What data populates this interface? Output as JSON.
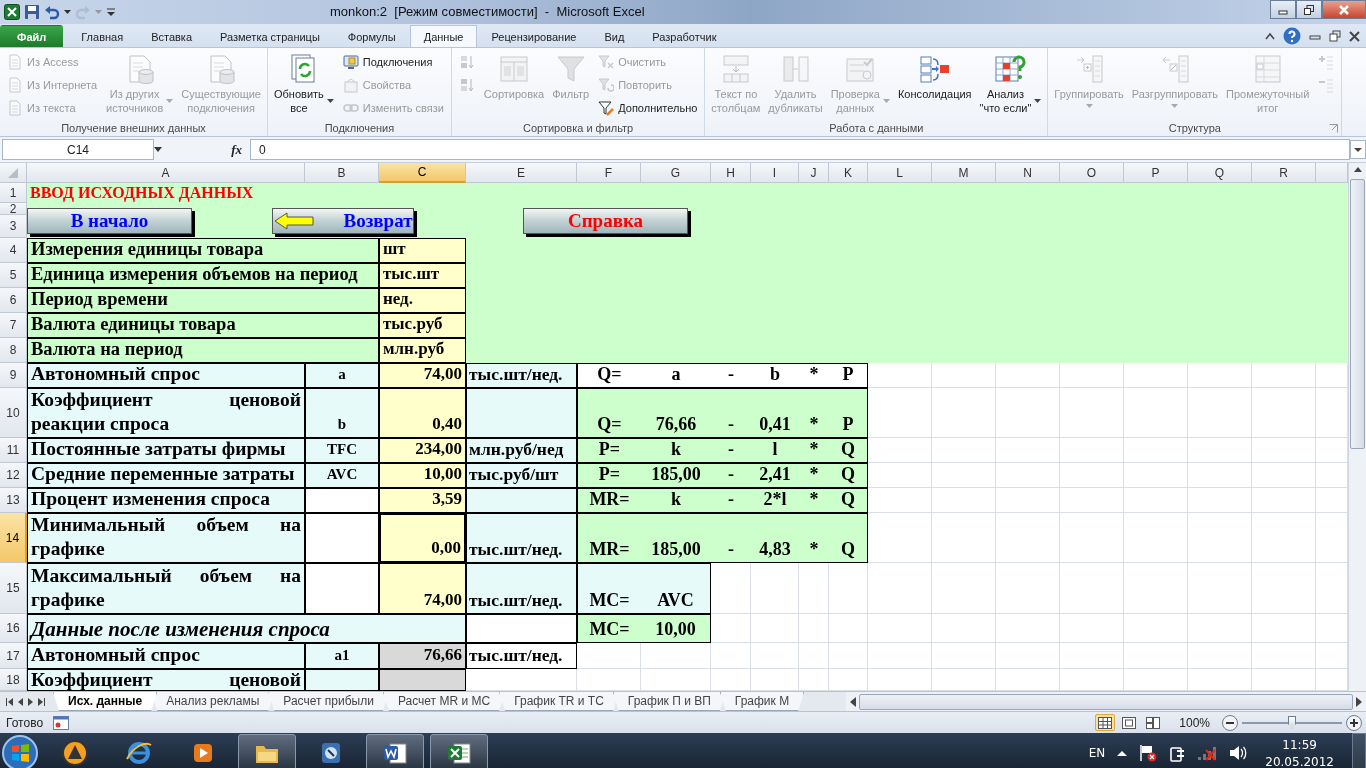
{
  "title_bar": {
    "title": "monkon:2  [Режим совместимости]  -  Microsoft Excel"
  },
  "ribbon_tabs": [
    {
      "label": "Файл",
      "kind": "file",
      "selected": false
    },
    {
      "label": "Главная",
      "kind": "tab",
      "selected": false
    },
    {
      "label": "Вставка",
      "kind": "tab",
      "selected": false
    },
    {
      "label": "Разметка страницы",
      "kind": "tab",
      "selected": false
    },
    {
      "label": "Формулы",
      "kind": "tab",
      "selected": false
    },
    {
      "label": "Данные",
      "kind": "tab",
      "selected": true
    },
    {
      "label": "Рецензирование",
      "kind": "tab",
      "selected": false
    },
    {
      "label": "Вид",
      "kind": "tab",
      "selected": false
    },
    {
      "label": "Разработчик",
      "kind": "tab",
      "selected": false
    }
  ],
  "ribbon_groups": [
    {
      "title": "Получение внешних данных",
      "launcher": false,
      "items": [
        {
          "kind": "small",
          "label": "Из Access",
          "disabled": true
        },
        {
          "kind": "small",
          "label": "Из Интернета",
          "disabled": true
        },
        {
          "kind": "small",
          "label": "Из текста",
          "disabled": true
        },
        {
          "kind": "large",
          "label": "Из других\nисточников",
          "disabled": true,
          "dropdown": true
        },
        {
          "kind": "large",
          "label": "Существующие\nподключения",
          "disabled": true,
          "dropdown": false
        }
      ]
    },
    {
      "title": "Подключения",
      "launcher": false,
      "items": [
        {
          "kind": "large",
          "label": "Обновить\nвсе",
          "disabled": false,
          "dropdown": true
        },
        {
          "kind": "small",
          "label": "Подключения",
          "disabled": false
        },
        {
          "kind": "small",
          "label": "Свойства",
          "disabled": true
        },
        {
          "kind": "small",
          "label": "Изменить связи",
          "disabled": true
        }
      ]
    },
    {
      "title": "Сортировка и фильтр",
      "launcher": false,
      "items": [
        {
          "kind": "icon",
          "disabled": true
        },
        {
          "kind": "icon",
          "disabled": true
        },
        {
          "kind": "large",
          "label": "Сортировка",
          "disabled": true,
          "dropdown": false
        },
        {
          "kind": "large",
          "label": "Фильтр",
          "disabled": true,
          "dropdown": false
        },
        {
          "kind": "small",
          "label": "Очистить",
          "disabled": true
        },
        {
          "kind": "small",
          "label": "Повторить",
          "disabled": true
        },
        {
          "kind": "small",
          "label": "Дополнительно",
          "disabled": false
        }
      ]
    },
    {
      "title": "Работа с данными",
      "launcher": false,
      "items": [
        {
          "kind": "large",
          "label": "Текст по\nстолбцам",
          "disabled": true,
          "dropdown": false
        },
        {
          "kind": "large",
          "label": "Удалить\nдубликаты",
          "disabled": true,
          "dropdown": false
        },
        {
          "kind": "large",
          "label": "Проверка\nданных",
          "disabled": true,
          "dropdown": true
        },
        {
          "kind": "large",
          "label": "Консолидация",
          "disabled": false,
          "dropdown": false
        },
        {
          "kind": "large",
          "label": "Анализ\n\"что если\"",
          "disabled": false,
          "dropdown": true
        }
      ]
    },
    {
      "title": "Структура",
      "launcher": true,
      "items": [
        {
          "kind": "large",
          "label": "Группировать",
          "disabled": true,
          "dropdown": true
        },
        {
          "kind": "large",
          "label": "Разгруппировать",
          "disabled": true,
          "dropdown": true
        },
        {
          "kind": "large",
          "label": "Промежуточный\nитог",
          "disabled": true,
          "dropdown": false
        },
        {
          "kind": "icon",
          "disabled": true
        },
        {
          "kind": "icon",
          "disabled": true
        }
      ]
    }
  ],
  "formula_bar": {
    "name_box": "C14",
    "function_label": "fx",
    "formula": "0"
  },
  "sheet": {
    "columns": [
      {
        "label": "A",
        "selected": false
      },
      {
        "label": "B",
        "selected": false
      },
      {
        "label": "C",
        "selected": true
      },
      {
        "label": "E",
        "selected": false
      },
      {
        "label": "F",
        "selected": false
      },
      {
        "label": "G",
        "selected": false
      },
      {
        "label": "H",
        "selected": false
      },
      {
        "label": "I",
        "selected": false
      },
      {
        "label": "J",
        "selected": false
      },
      {
        "label": "K",
        "selected": false
      },
      {
        "label": "L",
        "selected": false
      },
      {
        "label": "M",
        "selected": false
      },
      {
        "label": "N",
        "selected": false
      },
      {
        "label": "O",
        "selected": false
      },
      {
        "label": "P",
        "selected": false
      },
      {
        "label": "Q",
        "selected": false
      },
      {
        "label": "R",
        "selected": false
      }
    ],
    "buttons": [
      {
        "label": "В начало",
        "color": "#0000ff",
        "arrow": false
      },
      {
        "label": "Возврат",
        "color": "#0000ff",
        "arrow": true
      },
      {
        "label": "Справка",
        "color": "#ff0000",
        "arrow": false
      }
    ],
    "rows": [
      {
        "label": "1",
        "selected": false,
        "color": "#ccffcc",
        "cells": [
          {
            "kind": "title",
            "text": "ВВОД ИСХОДНЫХ ДАННЫХ",
            "color": "#ccffcc"
          }
        ]
      },
      {
        "label": "2",
        "selected": false,
        "color": "#ccffcc",
        "cells": []
      },
      {
        "label": "3",
        "selected": false,
        "color": "#ccffcc",
        "cells": []
      },
      {
        "label": "4",
        "selected": false,
        "color": "#ccffcc",
        "cells": [
          {
            "kind": "label-wide",
            "text": "Измерения единицы товара",
            "color": "#ccffcc"
          },
          {
            "kind": "merged"
          },
          {
            "kind": "text-value",
            "text": "шт",
            "color": "#ffffcc"
          }
        ]
      },
      {
        "label": "5",
        "selected": false,
        "color": "#ccffcc",
        "cells": [
          {
            "kind": "label-wide",
            "text": "Единица измерения объемов на период",
            "color": "#ccffcc"
          },
          {
            "kind": "merged"
          },
          {
            "kind": "text-value",
            "text": "тыс.шт",
            "color": "#ffffcc"
          }
        ]
      },
      {
        "label": "6",
        "selected": false,
        "color": "#ccffcc",
        "cells": [
          {
            "kind": "label-wide",
            "text": "Период времени",
            "color": "#ccffcc"
          },
          {
            "kind": "merged"
          },
          {
            "kind": "text-value",
            "text": "нед.",
            "color": "#ffffcc"
          }
        ]
      },
      {
        "label": "7",
        "selected": false,
        "color": "#ccffcc",
        "cells": [
          {
            "kind": "label-wide",
            "text": "Валюта единицы товара",
            "color": "#ccffcc"
          },
          {
            "kind": "merged"
          },
          {
            "kind": "text-value",
            "text": "тыс.руб",
            "color": "#ffffcc"
          }
        ]
      },
      {
        "label": "8",
        "selected": false,
        "color": "#ccffcc",
        "cells": [
          {
            "kind": "label-wide",
            "text": "Валюта на период",
            "color": "#ccffcc"
          },
          {
            "kind": "merged"
          },
          {
            "kind": "text-value",
            "text": "млн.руб",
            "color": "#ffffcc"
          }
        ]
      },
      {
        "label": "9",
        "selected": false,
        "color": "#ffffff",
        "cells": [
          {
            "kind": "label",
            "text": "Автономный  спрос",
            "color": "#e6fafa"
          },
          {
            "kind": "symbol",
            "text": "a",
            "color": "#e6fafa"
          },
          {
            "kind": "value",
            "text": "74,00",
            "color": "#ffffcc"
          },
          {
            "kind": "unit",
            "text": "тыс.шт/нед.",
            "color": "#e6fafa"
          },
          {
            "kind": "eq",
            "text": "Q=",
            "color": "#ffffff"
          },
          {
            "kind": "eq",
            "text": "a",
            "color": "#ffffff"
          },
          {
            "kind": "eq",
            "text": "-",
            "color": "#ffffff"
          },
          {
            "kind": "eq",
            "text": "b",
            "color": "#ffffff"
          },
          {
            "kind": "eq",
            "text": "*",
            "color": "#ffffff"
          },
          {
            "kind": "eq",
            "text": "P",
            "color": "#ffffff"
          }
        ]
      },
      {
        "label": "10",
        "selected": false,
        "color": "#ffffff",
        "cells": [
          {
            "kind": "label",
            "text": "Коэффициент ценовой реакции  спроса",
            "color": "#e6fafa"
          },
          {
            "kind": "symbol",
            "text": "b",
            "color": "#e6fafa"
          },
          {
            "kind": "value",
            "text": "0,40",
            "color": "#ffffcc"
          },
          {
            "kind": "blank",
            "color": "#e6fafa"
          },
          {
            "kind": "eq",
            "text": "Q=",
            "color": "#ccffcc"
          },
          {
            "kind": "eq",
            "text": "76,66",
            "color": "#ccffcc"
          },
          {
            "kind": "eq",
            "text": "-",
            "color": "#ccffcc"
          },
          {
            "kind": "eq",
            "text": "0,41",
            "color": "#ccffcc"
          },
          {
            "kind": "eq",
            "text": "*",
            "color": "#ccffcc"
          },
          {
            "kind": "eq",
            "text": "P",
            "color": "#ccffcc"
          }
        ]
      },
      {
        "label": "11",
        "selected": false,
        "color": "#ffffff",
        "cells": [
          {
            "kind": "label",
            "text": "Постоянные затраты фирмы",
            "color": "#e6fafa"
          },
          {
            "kind": "symbol",
            "text": "TFC",
            "color": "#e6fafa"
          },
          {
            "kind": "value",
            "text": "234,00",
            "color": "#ffffcc"
          },
          {
            "kind": "unit",
            "text": "млн.руб/нед",
            "color": "#e6fafa"
          },
          {
            "kind": "eq",
            "text": "P=",
            "color": "#ccffcc"
          },
          {
            "kind": "eq",
            "text": "k",
            "color": "#ccffcc"
          },
          {
            "kind": "eq",
            "text": "-",
            "color": "#ccffcc"
          },
          {
            "kind": "eq",
            "text": "l",
            "color": "#ccffcc"
          },
          {
            "kind": "eq",
            "text": "*",
            "color": "#ccffcc"
          },
          {
            "kind": "eq",
            "text": "Q",
            "color": "#ccffcc"
          }
        ]
      },
      {
        "label": "12",
        "selected": false,
        "color": "#ffffff",
        "cells": [
          {
            "kind": "label",
            "text": "Средние переменные затраты",
            "color": "#e6fafa"
          },
          {
            "kind": "symbol",
            "text": "AVC",
            "color": "#e6fafa"
          },
          {
            "kind": "value",
            "text": "10,00",
            "color": "#ffffcc"
          },
          {
            "kind": "unit",
            "text": "тыс.руб/шт",
            "color": "#e6fafa"
          },
          {
            "kind": "eq",
            "text": "P=",
            "color": "#ccffcc"
          },
          {
            "kind": "eq",
            "text": "185,00",
            "color": "#ccffcc"
          },
          {
            "kind": "eq",
            "text": "-",
            "color": "#ccffcc"
          },
          {
            "kind": "eq",
            "text": "2,41",
            "color": "#ccffcc"
          },
          {
            "kind": "eq",
            "text": "*",
            "color": "#ccffcc"
          },
          {
            "kind": "eq",
            "text": "Q",
            "color": "#ccffcc"
          }
        ]
      },
      {
        "label": "13",
        "selected": false,
        "color": "#ffffff",
        "cells": [
          {
            "kind": "label",
            "text": "Процент изменения  спроса",
            "color": "#e6fafa"
          },
          {
            "kind": "blank",
            "color": "#ffffff"
          },
          {
            "kind": "value",
            "text": "3,59",
            "color": "#ffffcc"
          },
          {
            "kind": "blank",
            "color": "#e6fafa"
          },
          {
            "kind": "eq",
            "text": "MR=",
            "color": "#ccffcc"
          },
          {
            "kind": "eq",
            "text": "k",
            "color": "#ccffcc"
          },
          {
            "kind": "eq",
            "text": "-",
            "color": "#ccffcc"
          },
          {
            "kind": "eq",
            "text": "2*l",
            "color": "#ccffcc"
          },
          {
            "kind": "eq",
            "text": "*",
            "color": "#ccffcc"
          },
          {
            "kind": "eq",
            "text": "Q",
            "color": "#ccffcc"
          }
        ]
      },
      {
        "label": "14",
        "selected": true,
        "color": "#ffffff",
        "cells": [
          {
            "kind": "label",
            "text": "Минимальный объем на графике",
            "color": "#e6fafa"
          },
          {
            "kind": "blank",
            "color": "#ffffff"
          },
          {
            "kind": "value",
            "text": "0,00",
            "color": "#ffffcc"
          },
          {
            "kind": "unit",
            "text": "тыс.шт/нед.",
            "color": "#e6fafa"
          },
          {
            "kind": "eq",
            "text": "MR=",
            "color": "#ccffcc"
          },
          {
            "kind": "eq",
            "text": "185,00",
            "color": "#ccffcc"
          },
          {
            "kind": "eq",
            "text": "-",
            "color": "#ccffcc"
          },
          {
            "kind": "eq",
            "text": "4,83",
            "color": "#ccffcc"
          },
          {
            "kind": "eq",
            "text": "*",
            "color": "#ccffcc"
          },
          {
            "kind": "eq",
            "text": "Q",
            "color": "#ccffcc"
          }
        ]
      },
      {
        "label": "15",
        "selected": false,
        "color": "#ffffff",
        "cells": [
          {
            "kind": "label",
            "text": "Максимальный объем на графике",
            "color": "#e6fafa"
          },
          {
            "kind": "blank",
            "color": "#ffffff"
          },
          {
            "kind": "value",
            "text": "74,00",
            "color": "#ffffcc"
          },
          {
            "kind": "unit",
            "text": "тыс.шт/нед.",
            "color": "#e6fafa"
          },
          {
            "kind": "eq",
            "text": "MC=",
            "color": "#e6fafa"
          },
          {
            "kind": "eq",
            "text": "AVC",
            "color": "#e6fafa"
          }
        ]
      },
      {
        "label": "16",
        "selected": false,
        "color": "#ffffff",
        "cells": [
          {
            "kind": "section",
            "text": "Данные после изменения спроса",
            "color": "#e6fafa"
          },
          {
            "kind": "merged"
          },
          {
            "kind": "merged"
          },
          {
            "kind": "blank",
            "color": "#ffffff"
          },
          {
            "kind": "eq",
            "text": "MC=",
            "color": "#ccffcc"
          },
          {
            "kind": "eq",
            "text": "10,00",
            "color": "#ccffcc"
          }
        ]
      },
      {
        "label": "17",
        "selected": false,
        "color": "#ffffff",
        "cells": [
          {
            "kind": "label",
            "text": "Автономный  спрос",
            "color": "#e6fafa"
          },
          {
            "kind": "symbol",
            "text": "a1",
            "color": "#e6fafa"
          },
          {
            "kind": "value",
            "text": "76,66",
            "color": "#d9d9d9"
          },
          {
            "kind": "unit",
            "text": "тыс.шт/нед.",
            "color": "#ffffff"
          }
        ]
      },
      {
        "label": "18",
        "selected": false,
        "color": "#ffffff",
        "cells": [
          {
            "kind": "label-cut",
            "text": "Коэффициент ценовой",
            "color": "#e6fafa"
          },
          {
            "kind": "blank",
            "color": "#e6fafa"
          },
          {
            "kind": "blank",
            "color": "#d9d9d9"
          }
        ]
      }
    ]
  },
  "sheet_tabs": [
    {
      "label": "Исх. данные",
      "selected": true
    },
    {
      "label": "Анализ рекламы",
      "selected": false
    },
    {
      "label": "Расчет прибыли",
      "selected": false
    },
    {
      "label": "Расчет MR и MC",
      "selected": false
    },
    {
      "label": "График TR и TC",
      "selected": false
    },
    {
      "label": "График П и ВП",
      "selected": false
    },
    {
      "label": "График М",
      "selected": false
    }
  ],
  "status_bar": {
    "status": "Готово",
    "views": [
      {
        "selected": true
      },
      {
        "selected": false
      },
      {
        "selected": false
      }
    ],
    "zoom": {
      "label": "100%",
      "level": 0.5
    }
  },
  "taskbar": {
    "apps": [
      {
        "open": false
      },
      {
        "open": false
      },
      {
        "open": false
      },
      {
        "open": true
      },
      {
        "open": false
      },
      {
        "open": true
      },
      {
        "open": true
      }
    ],
    "language": "EN",
    "time": "11:59",
    "date": "20.05.2012"
  }
}
